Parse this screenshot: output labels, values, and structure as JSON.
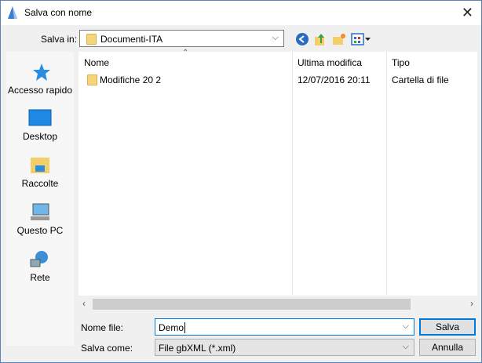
{
  "window": {
    "title": "Salva con nome",
    "close": "✕"
  },
  "toolbar": {
    "save_in_label": "Salva in:",
    "save_in_value": "Documenti-ITA"
  },
  "sidebar": {
    "items": [
      {
        "label": "Accesso rapido"
      },
      {
        "label": "Desktop"
      },
      {
        "label": "Raccolte"
      },
      {
        "label": "Questo PC"
      },
      {
        "label": "Rete"
      }
    ]
  },
  "list": {
    "columns": [
      "Nome",
      "Ultima modifica",
      "Tipo"
    ],
    "rows": [
      {
        "name": "Modifiche 20 2",
        "modified": "12/07/2016 20:11",
        "type": "Cartella di file"
      }
    ]
  },
  "form": {
    "filename_label": "Nome file:",
    "filename_value": "Demo",
    "saveas_label": "Salva come:",
    "saveas_value": "File gbXML (*.xml)",
    "save_button": "Salva",
    "cancel_button": "Annulla"
  }
}
